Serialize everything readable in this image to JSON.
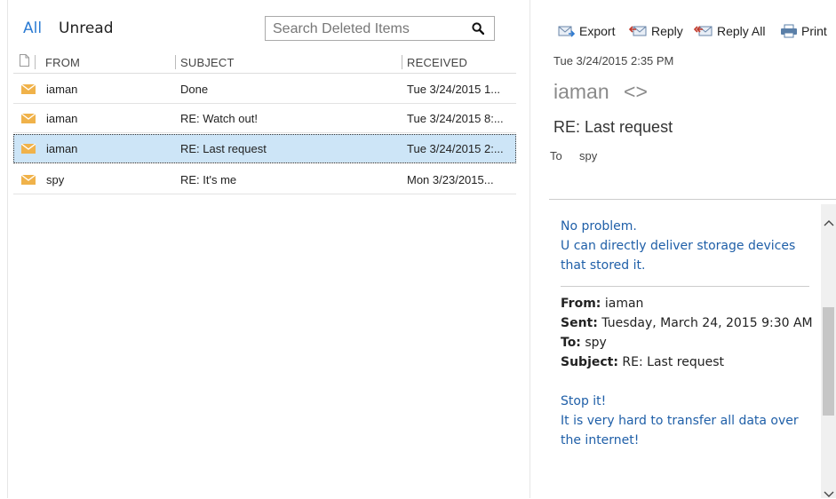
{
  "filters": {
    "all_label": "All",
    "unread_label": "Unread"
  },
  "search": {
    "placeholder": "Search Deleted Items",
    "icon": "search-icon"
  },
  "list": {
    "columns": {
      "from": "FROM",
      "subject": "SUBJECT",
      "received": "RECEIVED"
    },
    "rows": [
      {
        "from": "iaman",
        "subject": "Done",
        "received": "Tue 3/24/2015 1...",
        "selected": false
      },
      {
        "from": "iaman",
        "subject": "RE: Watch out!",
        "received": "Tue 3/24/2015 8:...",
        "selected": false
      },
      {
        "from": "iaman",
        "subject": "RE: Last request",
        "received": "Tue 3/24/2015 2:...",
        "selected": true
      },
      {
        "from": "spy",
        "subject": "RE: It's me",
        "received": "Mon 3/23/2015...",
        "selected": false
      }
    ]
  },
  "toolbar": {
    "export_label": "Export",
    "reply_label": "Reply",
    "reply_all_label": "Reply All",
    "print_label": "Print"
  },
  "message": {
    "date": "Tue 3/24/2015 2:35 PM",
    "sender": "iaman",
    "sender_address": "<>",
    "subject": "RE: Last request",
    "to_label": "To",
    "to_value": "spy",
    "body_line1": "No problem.",
    "body_line2": "U can directly deliver storage devices that stored it.",
    "quoted": {
      "from_label": "From:",
      "from_value": "iaman",
      "sent_label": "Sent:",
      "sent_value": "Tuesday, March 24, 2015 9:30 AM",
      "to_label": "To:",
      "to_value": "spy",
      "subject_label": "Subject:",
      "subject_value": "RE: Last request"
    },
    "quoted_body_line1": "Stop it!",
    "quoted_body_line2": "It is very hard to transfer all data over the internet!"
  },
  "colors": {
    "accent": "#2b7bd3",
    "selected_row": "#cde5f7",
    "envelope": "#f0b24a",
    "body_blue": "#1f5fa8"
  }
}
